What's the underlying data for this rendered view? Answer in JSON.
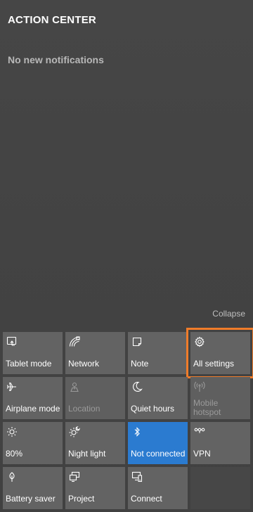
{
  "header": {
    "title": "ACTION CENTER"
  },
  "notifications": {
    "empty_message": "No new notifications"
  },
  "collapse_label": "Collapse",
  "colors": {
    "active_tile": "#2b7bd0",
    "highlight_outline": "#f07c2a",
    "tile": "#636363"
  },
  "quick_actions": [
    {
      "label": "Tablet mode",
      "icon": "tablet-mode-icon",
      "state": "off"
    },
    {
      "label": "Network",
      "icon": "network-icon",
      "state": "off"
    },
    {
      "label": "Note",
      "icon": "note-icon",
      "state": "off"
    },
    {
      "label": "All settings",
      "icon": "gear-icon",
      "state": "highlighted"
    },
    {
      "label": "Airplane mode",
      "icon": "airplane-icon",
      "state": "off"
    },
    {
      "label": "Location",
      "icon": "location-icon",
      "state": "disabled"
    },
    {
      "label": "Quiet hours",
      "icon": "moon-icon",
      "state": "off"
    },
    {
      "label": "Mobile hotspot",
      "icon": "hotspot-icon",
      "state": "disabled"
    },
    {
      "label": "80%",
      "icon": "brightness-icon",
      "state": "off"
    },
    {
      "label": "Night light",
      "icon": "night-light-icon",
      "state": "off"
    },
    {
      "label": "Not connected",
      "icon": "bluetooth-icon",
      "state": "active"
    },
    {
      "label": "VPN",
      "icon": "vpn-icon",
      "state": "off"
    },
    {
      "label": "Battery saver",
      "icon": "battery-saver-icon",
      "state": "off"
    },
    {
      "label": "Project",
      "icon": "project-icon",
      "state": "off"
    },
    {
      "label": "Connect",
      "icon": "connect-icon",
      "state": "off"
    }
  ]
}
